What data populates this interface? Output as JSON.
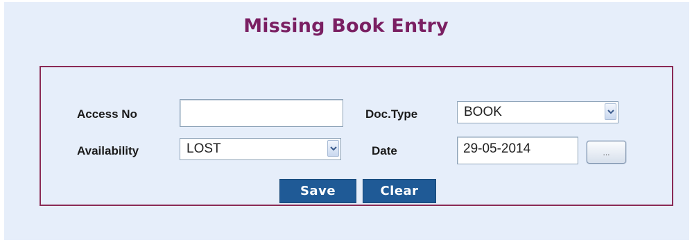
{
  "page": {
    "title": "Missing Book Entry"
  },
  "form": {
    "access_no": {
      "label": "Access No",
      "value": ""
    },
    "doc_type": {
      "label": "Doc.Type",
      "selected": "BOOK"
    },
    "availability": {
      "label": "Availability",
      "selected": "LOST"
    },
    "date": {
      "label": "Date",
      "value": "29-05-2014",
      "picker_label": "..."
    }
  },
  "actions": {
    "save_label": "Save",
    "clear_label": "Clear"
  },
  "colors": {
    "page_bg": "#e6eefa",
    "title": "#7a1f62",
    "form_border": "#8a2a55",
    "button_bg": "#1f5a96"
  },
  "icons": {
    "dropdown": "chevron-down-icon"
  }
}
